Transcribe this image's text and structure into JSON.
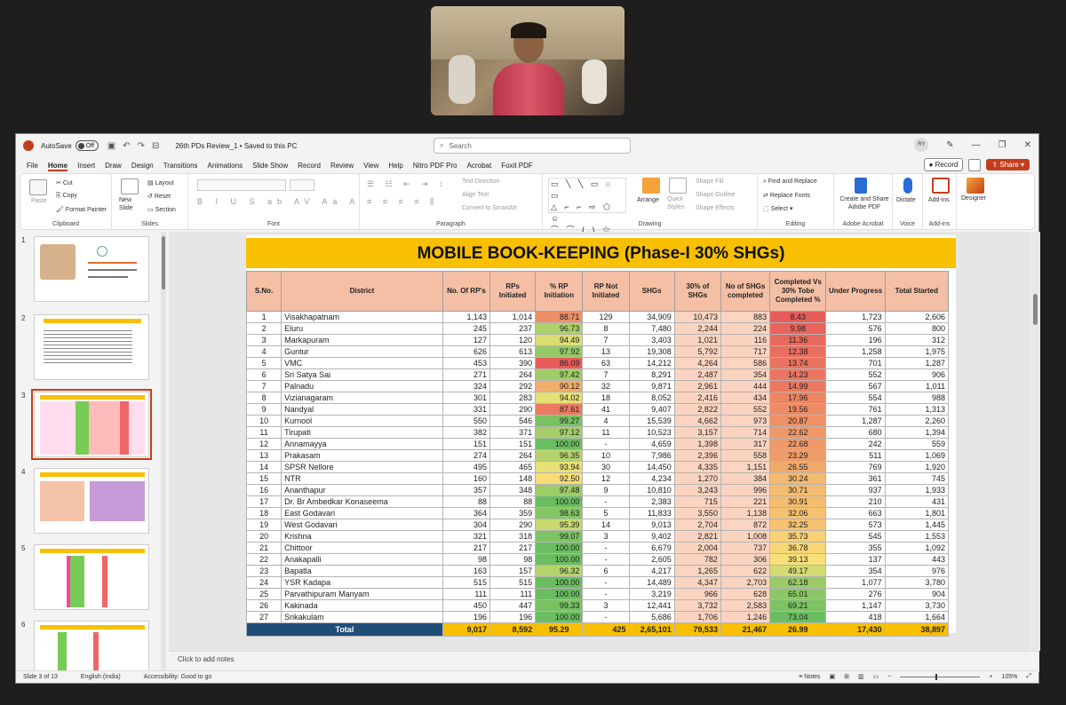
{
  "app": {
    "autosave_label": "AutoSave",
    "autosave_state": "Off",
    "doc_title": "26th PDs Review_1 • Saved to this PC",
    "search_placeholder": "Search",
    "user_initials": "RY"
  },
  "menu": {
    "tabs": [
      "File",
      "Home",
      "Insert",
      "Draw",
      "Design",
      "Transitions",
      "Animations",
      "Slide Show",
      "Record",
      "Review",
      "View",
      "Help",
      "Nitro PDF Pro",
      "Acrobat",
      "Foxit PDF"
    ],
    "active": "Home",
    "record_label": "Record",
    "share_label": "Share"
  },
  "ribbon": {
    "clipboard": {
      "paste": "Paste",
      "cut": "Cut",
      "copy": "Copy",
      "format_painter": "Format Painter",
      "label": "Clipboard"
    },
    "slides": {
      "new_slide": "New Slide",
      "layout": "Layout",
      "reset": "Reset",
      "section": "Section",
      "label": "Slides"
    },
    "font": {
      "label": "Font"
    },
    "paragraph": {
      "text_direction": "Text Direction",
      "align_text": "Align Text",
      "smartart": "Convert to SmartArt",
      "label": "Paragraph"
    },
    "drawing": {
      "arrange": "Arrange",
      "quick_styles": "Quick Styles",
      "shape_fill": "Shape Fill",
      "shape_outline": "Shape Outline",
      "shape_effects": "Shape Effects",
      "label": "Drawing"
    },
    "editing": {
      "find_replace": "Find and Replace",
      "replace_fonts": "Replace Fonts",
      "select": "Select",
      "label": "Editing"
    },
    "acrobat": {
      "create_share": "Create and Share Adobe PDF",
      "label": "Adobe Acrobat"
    },
    "voice": {
      "dictate": "Dictate",
      "label": "Voice"
    },
    "addins": {
      "addins": "Add-ins",
      "label": "Add-ins"
    },
    "designer": {
      "designer": "Designer"
    }
  },
  "thumbnails": [
    "1",
    "2",
    "3",
    "4",
    "5",
    "6"
  ],
  "slide": {
    "title": "MOBILE BOOK-KEEPING (Phase-I 30% SHGs)",
    "headers": [
      "S.No.",
      "District",
      "No. Of RP's",
      "RPs Initiated",
      "% RP Initiation",
      "RP Not Initiated",
      "SHGs",
      "30% of SHGs",
      "No of SHGs completed",
      "Completed Vs 30% Tobe Completed %",
      "Under Progress",
      "Total Started"
    ],
    "rows": [
      [
        "1",
        "Visakhapatnam",
        "1,143",
        "1,014",
        "88.71",
        "129",
        "34,909",
        "10,473",
        "883",
        "8.43",
        "1,723",
        "2,606"
      ],
      [
        "2",
        "Eluru",
        "245",
        "237",
        "96.73",
        "8",
        "7,480",
        "2,244",
        "224",
        "9.98",
        "576",
        "800"
      ],
      [
        "3",
        "Markapuram",
        "127",
        "120",
        "94.49",
        "7",
        "3,403",
        "1,021",
        "116",
        "11.36",
        "196",
        "312"
      ],
      [
        "4",
        "Guntur",
        "626",
        "613",
        "97.92",
        "13",
        "19,308",
        "5,792",
        "717",
        "12.38",
        "1,258",
        "1,975"
      ],
      [
        "5",
        "VMC",
        "453",
        "390",
        "86.09",
        "63",
        "14,212",
        "4,264",
        "586",
        "13.74",
        "701",
        "1,287"
      ],
      [
        "6",
        "Sri Satya Sai",
        "271",
        "264",
        "97.42",
        "7",
        "8,291",
        "2,487",
        "354",
        "14.23",
        "552",
        "906"
      ],
      [
        "7",
        "Palnadu",
        "324",
        "292",
        "90.12",
        "32",
        "9,871",
        "2,961",
        "444",
        "14.99",
        "567",
        "1,011"
      ],
      [
        "8",
        "Vizianagaram",
        "301",
        "283",
        "94.02",
        "18",
        "8,052",
        "2,416",
        "434",
        "17.96",
        "554",
        "988"
      ],
      [
        "9",
        "Nandyal",
        "331",
        "290",
        "87.61",
        "41",
        "9,407",
        "2,822",
        "552",
        "19.56",
        "761",
        "1,313"
      ],
      [
        "10",
        "Kurnool",
        "550",
        "546",
        "99.27",
        "4",
        "15,539",
        "4,662",
        "973",
        "20.87",
        "1,287",
        "2,260"
      ],
      [
        "11",
        "Tirupati",
        "382",
        "371",
        "97.12",
        "11",
        "10,523",
        "3,157",
        "714",
        "22.62",
        "680",
        "1,394"
      ],
      [
        "12",
        "Annamayya",
        "151",
        "151",
        "100.00",
        "-",
        "4,659",
        "1,398",
        "317",
        "22.68",
        "242",
        "559"
      ],
      [
        "13",
        "Prakasam",
        "274",
        "264",
        "96.35",
        "10",
        "7,986",
        "2,396",
        "558",
        "23.29",
        "511",
        "1,069"
      ],
      [
        "14",
        "SPSR Nellore",
        "495",
        "465",
        "93.94",
        "30",
        "14,450",
        "4,335",
        "1,151",
        "26.55",
        "769",
        "1,920"
      ],
      [
        "15",
        "NTR",
        "160",
        "148",
        "92.50",
        "12",
        "4,234",
        "1,270",
        "384",
        "30.24",
        "361",
        "745"
      ],
      [
        "16",
        "Ananthapur",
        "357",
        "348",
        "97.48",
        "9",
        "10,810",
        "3,243",
        "996",
        "30.71",
        "937",
        "1,933"
      ],
      [
        "17",
        "Dr. Br Ambedkar Konaseema",
        "88",
        "88",
        "100.00",
        "-",
        "2,383",
        "715",
        "221",
        "30.91",
        "210",
        "431"
      ],
      [
        "18",
        "East Godavari",
        "364",
        "359",
        "98.63",
        "5",
        "11,833",
        "3,550",
        "1,138",
        "32.06",
        "663",
        "1,801"
      ],
      [
        "19",
        "West Godavari",
        "304",
        "290",
        "95.39",
        "14",
        "9,013",
        "2,704",
        "872",
        "32.25",
        "573",
        "1,445"
      ],
      [
        "20",
        "Krishna",
        "321",
        "318",
        "99.07",
        "3",
        "9,402",
        "2,821",
        "1,008",
        "35.73",
        "545",
        "1,553"
      ],
      [
        "21",
        "Chittoor",
        "217",
        "217",
        "100.00",
        "-",
        "6,679",
        "2,004",
        "737",
        "36.78",
        "355",
        "1,092"
      ],
      [
        "22",
        "Anakapalli",
        "98",
        "98",
        "100.00",
        "-",
        "2,605",
        "782",
        "306",
        "39.13",
        "137",
        "443"
      ],
      [
        "23",
        "Bapatla",
        "163",
        "157",
        "96.32",
        "6",
        "4,217",
        "1,265",
        "622",
        "49.17",
        "354",
        "976"
      ],
      [
        "24",
        "YSR Kadapa",
        "515",
        "515",
        "100.00",
        "-",
        "14,489",
        "4,347",
        "2,703",
        "62.18",
        "1,077",
        "3,780"
      ],
      [
        "25",
        "Parvathipuram Manyam",
        "111",
        "111",
        "100.00",
        "-",
        "3,219",
        "966",
        "628",
        "65.01",
        "276",
        "904"
      ],
      [
        "26",
        "Kakinada",
        "450",
        "447",
        "99.33",
        "3",
        "12,441",
        "3,732",
        "2,583",
        "69.21",
        "1,147",
        "3,730"
      ],
      [
        "27",
        "Srikakulam",
        "196",
        "196",
        "100.00",
        "-",
        "5,686",
        "1,706",
        "1,246",
        "73.04",
        "418",
        "1,664"
      ]
    ],
    "total": [
      "Total",
      "9,017",
      "8,592",
      "95.29",
      "425",
      "2,65,101",
      "79,533",
      "21,467",
      "26.99",
      "17,430",
      "38,897"
    ]
  },
  "notes_placeholder": "Click to add notes",
  "status": {
    "slide": "Slide 3 of 13",
    "language": "English (India)",
    "accessibility": "Accessibility: Good to go",
    "notes": "Notes",
    "zoom": "105%"
  }
}
